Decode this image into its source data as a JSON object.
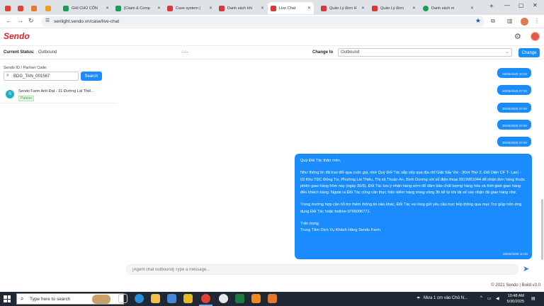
{
  "browser": {
    "tabs": [
      {
        "label": "",
        "color": "#e04336"
      },
      {
        "label": "",
        "color": "#d8483a"
      },
      {
        "label": "",
        "color": "#e07a30"
      },
      {
        "label": "GHI CHÚ CỐN",
        "color": "#1e9e55"
      },
      {
        "label": "[Claim & Comp",
        "color": "#1e9e55"
      },
      {
        "label": "Case system (",
        "color": "#d63b3b"
      },
      {
        "label": "Danh sách khi",
        "color": "#d63b3b"
      },
      {
        "label": "Live Chat",
        "color": "#d63b3b"
      },
      {
        "label": "Quản Lý Đơn H",
        "color": "#d63b3b"
      },
      {
        "label": "Quản Lý Đơn",
        "color": "#d63b3b"
      },
      {
        "label": "Danh sách m",
        "color": "#1e9e55"
      }
    ],
    "new_tab": "+",
    "url": "senlight.sendo.vn/case/live-chat"
  },
  "app": {
    "logo": "Sendo",
    "brand_color": "#e1232d",
    "accent_color": "#1a8cff"
  },
  "status": {
    "current_label": "Current Status:",
    "current_value": "Outbound",
    "middle": "-:-:-",
    "change_to_label": "Change to",
    "change_to_value": "Outbound",
    "change_button": "Change"
  },
  "search": {
    "label": "Sendo ID / Partner Code:",
    "value": "BDG_TAN_001567",
    "button": "Search"
  },
  "conversations": [
    {
      "avatar": "S",
      "name": "Sendo Farm Anh Đạt - 21 Đường Lái Thiê...",
      "tag": "Partner"
    }
  ],
  "messages": {
    "small": [
      "29/05/2025 10:04",
      "30/05/2025 07:00",
      "30/05/2025 07:00",
      "30/05/2025 07:00",
      "30/05/2025 07:00"
    ],
    "big": {
      "greeting": "Quý Đối Tác thân mến,",
      "para1": "Như thông tin đã trao đổi qua cuộc gọi, nhờ Quý Đối Tác sắp xếp qua địa chỉ Giặt Sấy Voi - (Kiot Thứ 2, Đối Diện CF T- Lan) - 02 Khu TĐC Đông Tư, Phường Lái Thiêu, Thị xã Thuận An, Bình Dương với số điện thoại 0919951044 để nhận đơn hàng thuộc phiên giao hàng hôm nay (ngày 30/5). Đối Tác lưu ý nhận hàng sớm để đảm bảo chất lượng hàng hóa và thời gian giao hàng đến khách hàng. Ngoài ra Đối Tác cũng cần thực hiện kiểm hàng trong vòng 3h kể từ khi tài xế xác nhận đã giao hàng nhé.",
      "para2": "Trong trường hợp cần hỗ trợ thêm thông tin nào khác, Đối Tác vui lòng gửi yêu cầu trực tiếp thông qua mục Trợ giúp trên ứng dụng Đối Tác hoặc hotline 0766006771.",
      "closing1": "Trân trọng,",
      "closing2": "Trung Tâm Dịch Vụ Khách Hàng Sendo Farm",
      "time": "30/05/2025 10:46"
    }
  },
  "composer": {
    "placeholder": "[Agent chat outbound] Type a message..."
  },
  "footer": "© 2021 Sendo | Build v3.0",
  "taskbar": {
    "search_placeholder": "Type here to search",
    "weather": "Mưa 1 cm vào Chủ N...",
    "time": "10:48 AM",
    "date": "5/30/2025"
  }
}
